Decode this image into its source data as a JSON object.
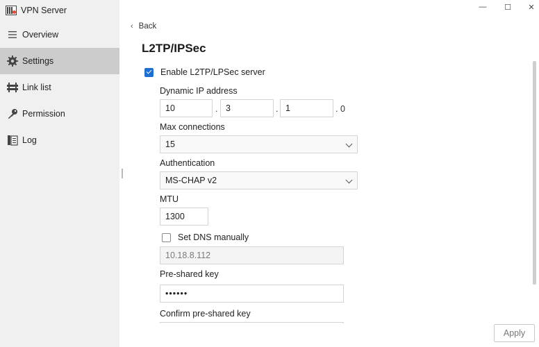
{
  "app": {
    "title": "VPN Server"
  },
  "window_controls": {
    "minimize": "—",
    "maximize": "☐",
    "close": "✕"
  },
  "sidebar": {
    "items": [
      {
        "label": "Overview",
        "icon": "menu-icon",
        "active": false
      },
      {
        "label": "Settings",
        "icon": "gear-icon",
        "active": true
      },
      {
        "label": "Link list",
        "icon": "link-list-icon",
        "active": false
      },
      {
        "label": "Permission",
        "icon": "key-icon",
        "active": false
      },
      {
        "label": "Log",
        "icon": "log-icon",
        "active": false
      }
    ]
  },
  "header": {
    "back_label": "Back",
    "title": "L2TP/IPSec"
  },
  "form": {
    "enable_label": "Enable L2TP/LPSec server",
    "enable_checked": true,
    "dynamic_ip_label": "Dynamic IP address",
    "ip_octets": [
      "10",
      "3",
      "1"
    ],
    "ip_last": ". 0",
    "ip_sep": ".",
    "max_conn_label": "Max connections",
    "max_conn_value": "15",
    "auth_label": "Authentication",
    "auth_value": "MS-CHAP v2",
    "mtu_label": "MTU",
    "mtu_value": "1300",
    "dns_label": "Set DNS manually",
    "dns_checked": false,
    "dns_value": "10.18.8.112",
    "psk_label": "Pre-shared key",
    "psk_value": "••••••",
    "confirm_psk_label": "Confirm pre-shared key"
  },
  "footer": {
    "apply_label": "Apply"
  },
  "colors": {
    "accent": "#1f6fd1",
    "sidebar_bg": "#f0f0f0",
    "sidebar_active": "#cccccc"
  }
}
